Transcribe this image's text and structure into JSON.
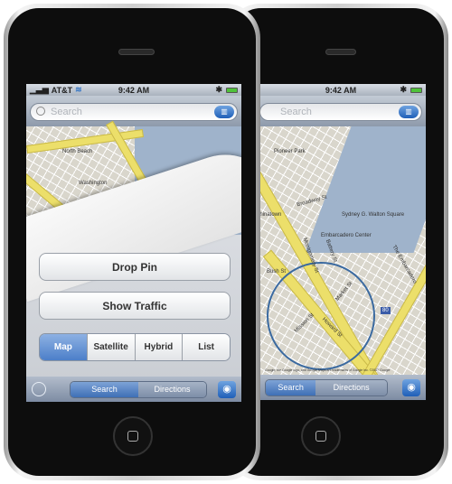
{
  "status": {
    "carrier": "AT&T",
    "time": "9:42 AM"
  },
  "search": {
    "placeholder": "Search"
  },
  "front": {
    "buttons": {
      "drop_pin": "Drop Pin",
      "show_traffic": "Show Traffic"
    },
    "map_types": [
      {
        "label": "Map",
        "selected": true
      },
      {
        "label": "Satellite"
      },
      {
        "label": "Hybrid"
      },
      {
        "label": "List"
      }
    ],
    "map_labels": [
      "North Beach",
      "Washington"
    ]
  },
  "toolbar": {
    "search": "Search",
    "directions": "Directions",
    "selected": "Search"
  },
  "back": {
    "map_labels": [
      "Pioneer Park",
      "Chinatown",
      "Broadway St",
      "Embarcadero Center",
      "Sydney G. Walton Square",
      "Bush St",
      "Montgomery St",
      "Battery St",
      "Market St",
      "Mission St",
      "Howard St",
      "The Embarcadero",
      "80"
    ],
    "copyright": "Google, the Google logo, and Google Maps are trademarks of Google Inc. ©2007 Google"
  },
  "colors": {
    "accent": "#3e6fb6",
    "road": "#ecdf6a",
    "water": "#9fb3cb"
  }
}
